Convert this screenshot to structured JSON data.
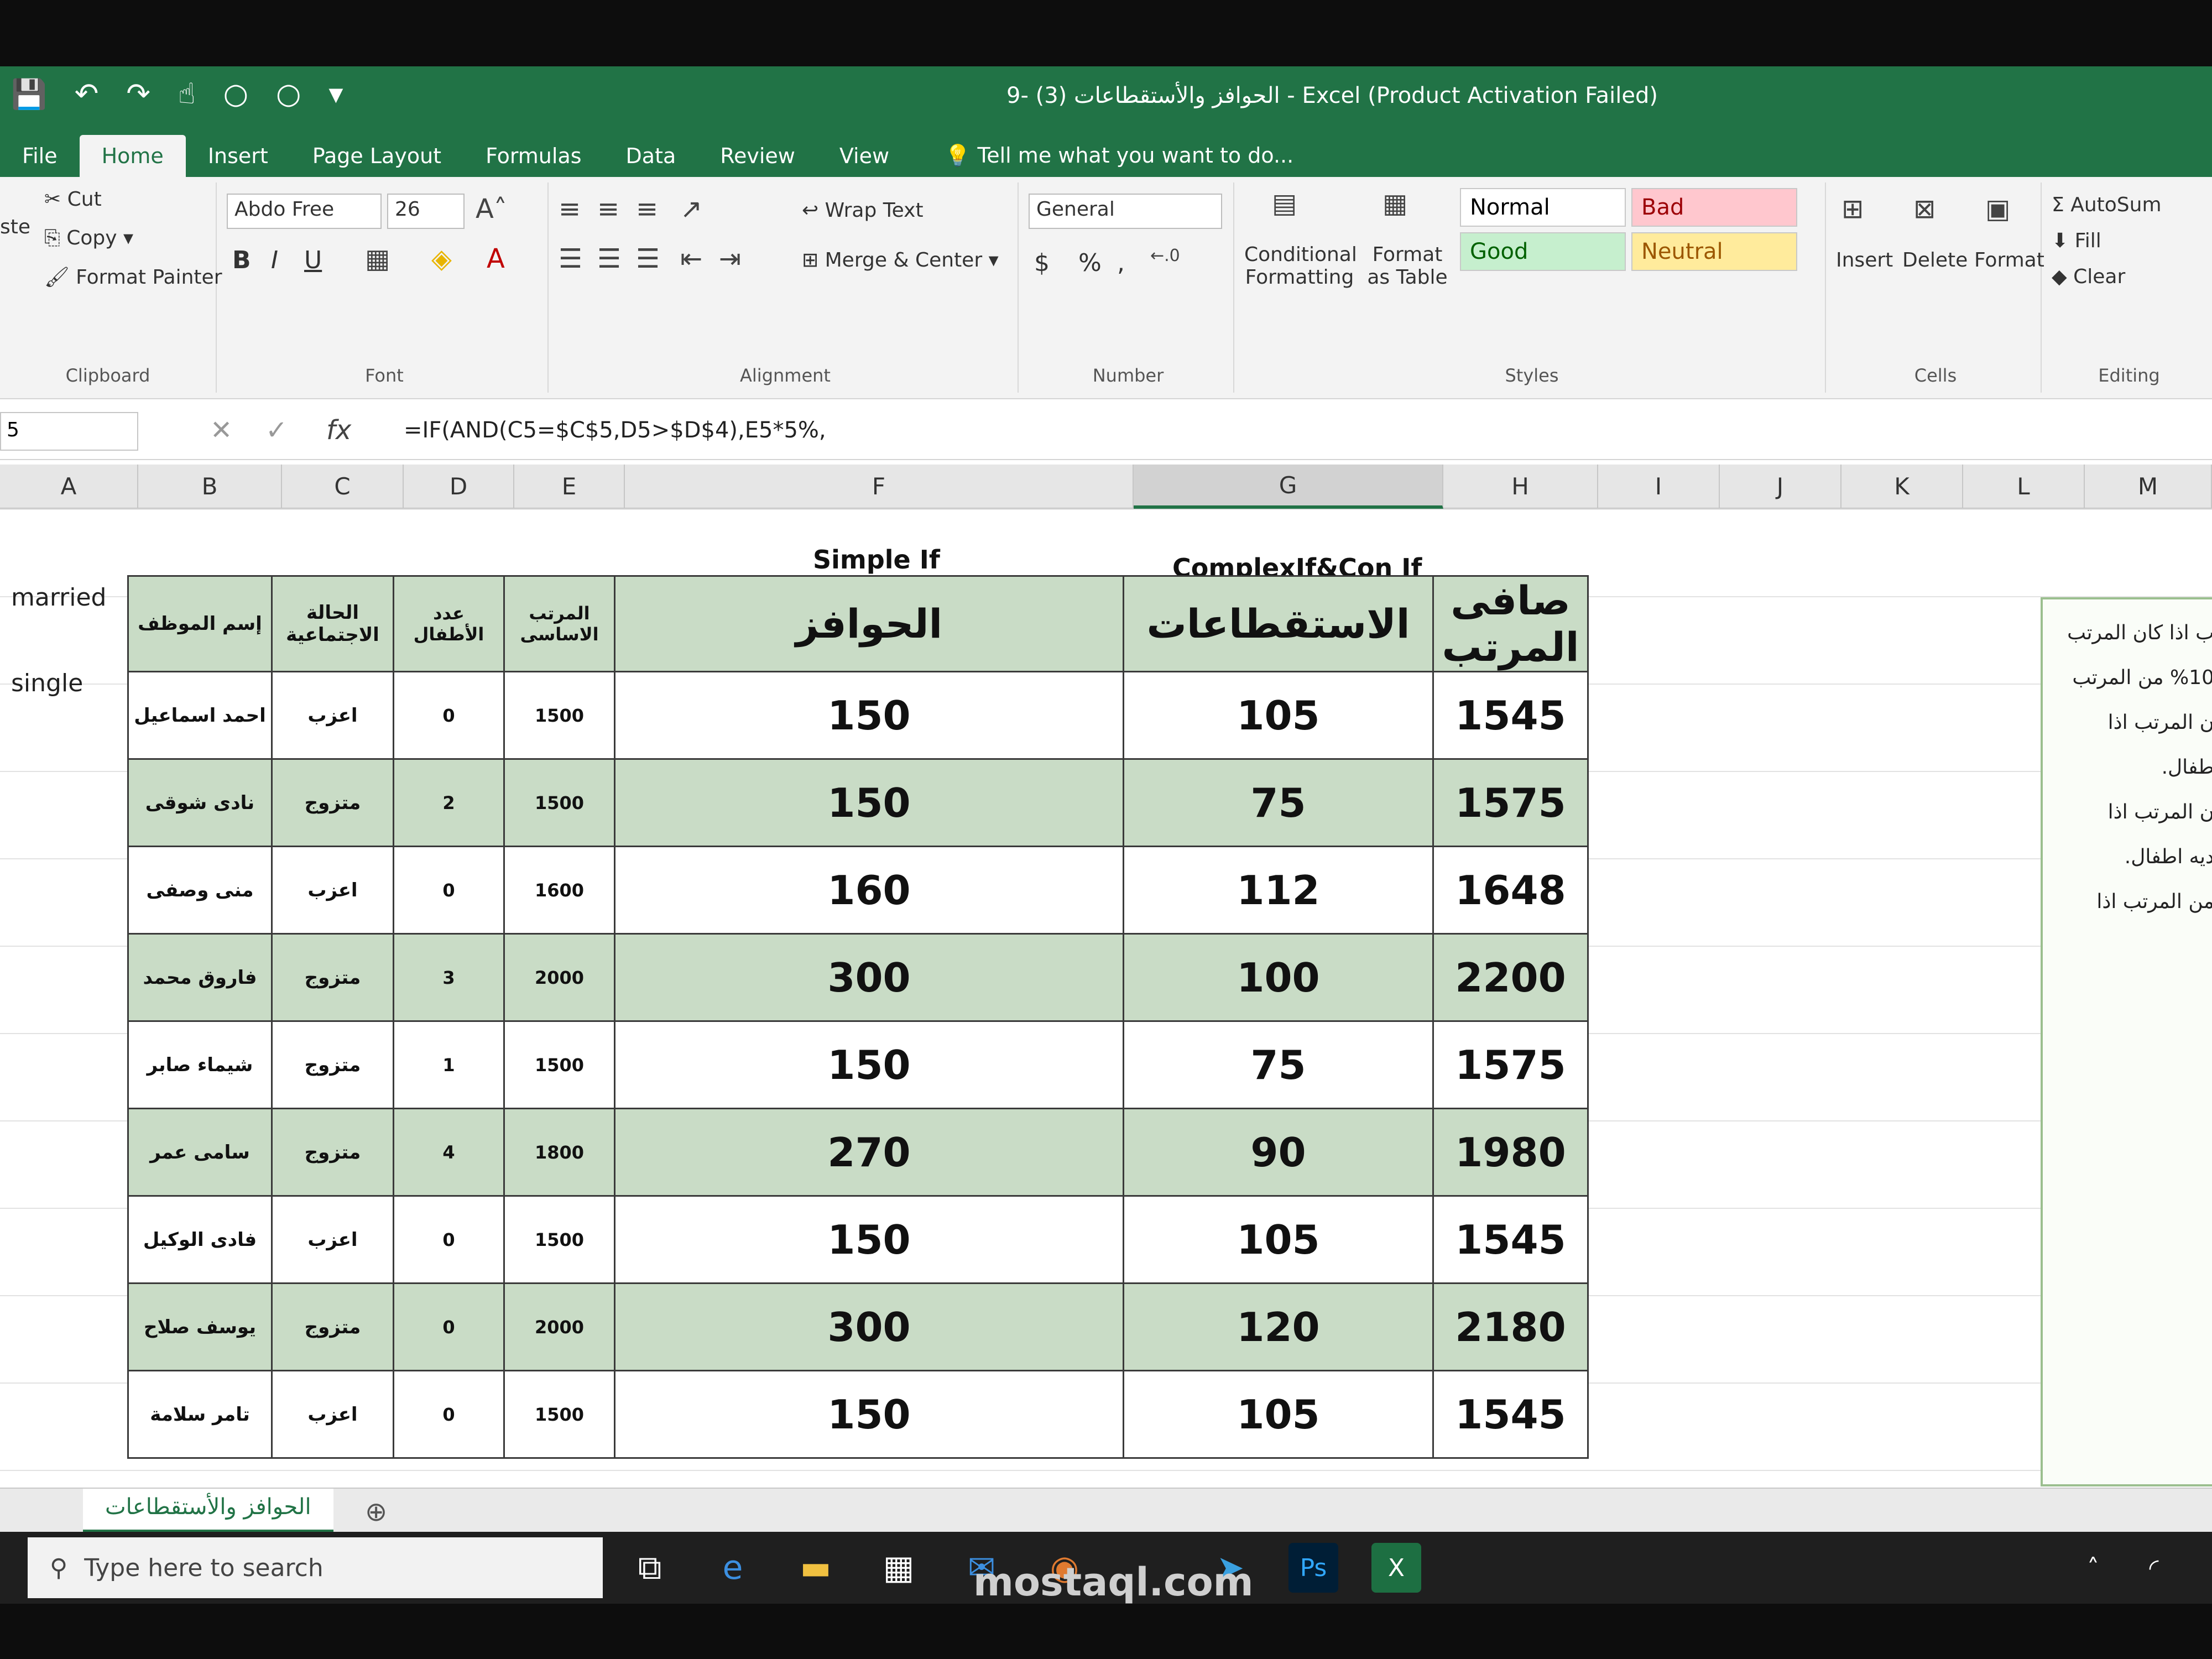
{
  "window": {
    "title": "الحوافز والأستقطاعات (3) -9 - Excel (Product Activation Failed)"
  },
  "tabs": [
    "File",
    "Home",
    "Insert",
    "Page Layout",
    "Formulas",
    "Data",
    "Review",
    "View"
  ],
  "tell_me": "Tell me what you want to do...",
  "ribbon": {
    "clipboard": {
      "cut": "Cut",
      "copy": "Copy",
      "format_painter": "Format Painter",
      "label": "Clipboard",
      "paste": "ste"
    },
    "font": {
      "name": "Abdo Free",
      "size": "26",
      "bold": "B",
      "italic": "I",
      "underline": "U",
      "label": "Font"
    },
    "alignment": {
      "wrap": "Wrap Text",
      "merge": "Merge & Center",
      "label": "Alignment"
    },
    "number": {
      "format": "General",
      "currency": "$",
      "percent": "%",
      "comma": ",",
      "label": "Number"
    },
    "styles": {
      "conditional": "Conditional Formatting",
      "format_table": "Format as Table",
      "normal": "Normal",
      "bad": "Bad",
      "good": "Good",
      "neutral": "Neutral",
      "label": "Styles"
    },
    "cells": {
      "insert": "Insert",
      "delete": "Delete",
      "format": "Format",
      "label": "Cells"
    },
    "editing": {
      "autosum": "AutoSum",
      "fill": "Fill",
      "clear": "Clear",
      "label": "Editing"
    }
  },
  "formula_bar": {
    "name_box": "5",
    "formula": "=IF(AND(C5=$C$5,D5>$D$4),E5*5%,"
  },
  "columns": [
    "A",
    "B",
    "C",
    "D",
    "E",
    "F",
    "G",
    "H",
    "I",
    "J",
    "K",
    "L",
    "M"
  ],
  "left_labels": {
    "married": "married",
    "single": "single"
  },
  "sections": {
    "simple_if": "Simple If",
    "complex_if": "ComplexIf&Con If"
  },
  "table": {
    "headers": [
      "إسم الموظف",
      "الحالة الاجتماعية",
      "عدد الأطفال",
      "المرتب الاساسى",
      "الحوافز",
      "الاستقطاعات",
      "صافى المرتب"
    ],
    "rows": [
      [
        "احمد اسماعيل",
        "اعزب",
        "0",
        "1500",
        "150",
        "105",
        "1545"
      ],
      [
        "نادى شوقى",
        "متزوج",
        "2",
        "1500",
        "150",
        "75",
        "1575"
      ],
      [
        "منى وصفى",
        "اعزب",
        "0",
        "1600",
        "160",
        "112",
        "1648"
      ],
      [
        "فاروق محمد",
        "متزوج",
        "3",
        "2000",
        "300",
        "100",
        "2200"
      ],
      [
        "شيماء صابر",
        "متزوج",
        "1",
        "1500",
        "150",
        "75",
        "1575"
      ],
      [
        "سامى عمر",
        "متزوج",
        "4",
        "1800",
        "270",
        "90",
        "1980"
      ],
      [
        "فادى الوكيل",
        "اعزب",
        "0",
        "1500",
        "150",
        "105",
        "1545"
      ],
      [
        "يوسف صلاح",
        "متزوج",
        "0",
        "2000",
        "300",
        "120",
        "2180"
      ],
      [
        "تامر سلامة",
        "اعزب",
        "0",
        "1500",
        "150",
        "105",
        "1545"
      ]
    ]
  },
  "side_notes": [
    "ب اذا كان المرتب",
    "%10 من المرتب",
    "ن المرتب اذا",
    "طفال.",
    "ن المرتب اذا",
    "ديه اطفال.",
    "من المرتب اذا"
  ],
  "sheet_tab": "الحوافز والأستقطاعات",
  "taskbar": {
    "search_placeholder": "Type here to search"
  },
  "watermark": "mostaql.com"
}
